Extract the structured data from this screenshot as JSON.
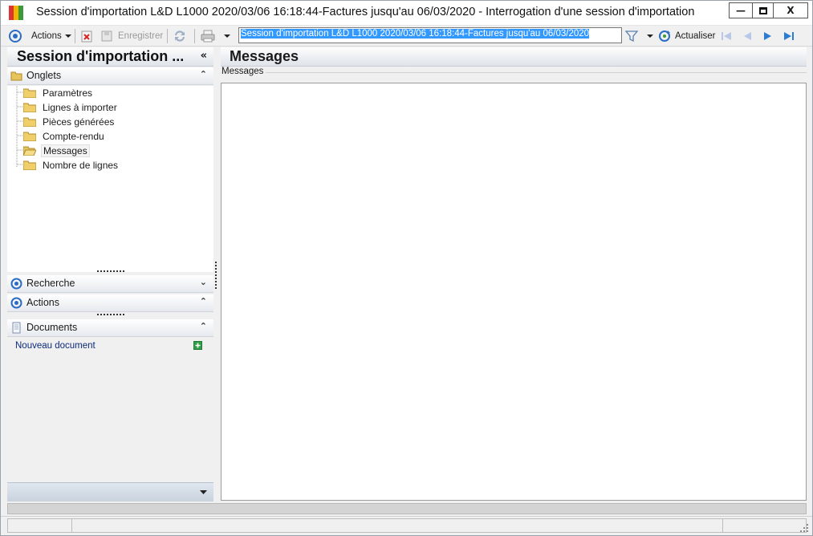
{
  "window": {
    "title": "Session d'importation L&D L1000 2020/03/06 16:18:44-Factures jusqu'au 06/03/2020 -  Interrogation d'une session d'importation",
    "minimize_glyph": "—",
    "maximize_glyph": "□",
    "close_glyph": "X"
  },
  "toolbar": {
    "actions_label": "Actions",
    "save_label": "Enregistrer",
    "session_value": "Session d'importation L&D L1000 2020/03/06 16:18:44-Factures jusqu'au 06/03/2020",
    "refresh_label": "Actualiser"
  },
  "left_panel": {
    "title": "Session d'importation ...",
    "collapse_glyph": "«",
    "tabs_section": {
      "label": "Onglets",
      "items": [
        "Paramètres",
        "Lignes à importer",
        "Pièces générées",
        "Compte-rendu",
        "Messages",
        "Nombre de lignes"
      ],
      "selected": "Messages"
    },
    "search_section": {
      "label": "Recherche"
    },
    "actions_section": {
      "label": "Actions"
    },
    "documents_section": {
      "label": "Documents",
      "new_document_link": "Nouveau document"
    }
  },
  "right_panel": {
    "title": "Messages",
    "group_label": "Messages"
  },
  "colors": {
    "selection_blue": "#3399ff",
    "header_gradient_top": "#fdfdfd",
    "header_gradient_bottom": "#dfe4ea",
    "nav_blue": "#2b7cd3",
    "link_blue": "#0b2a7a"
  }
}
